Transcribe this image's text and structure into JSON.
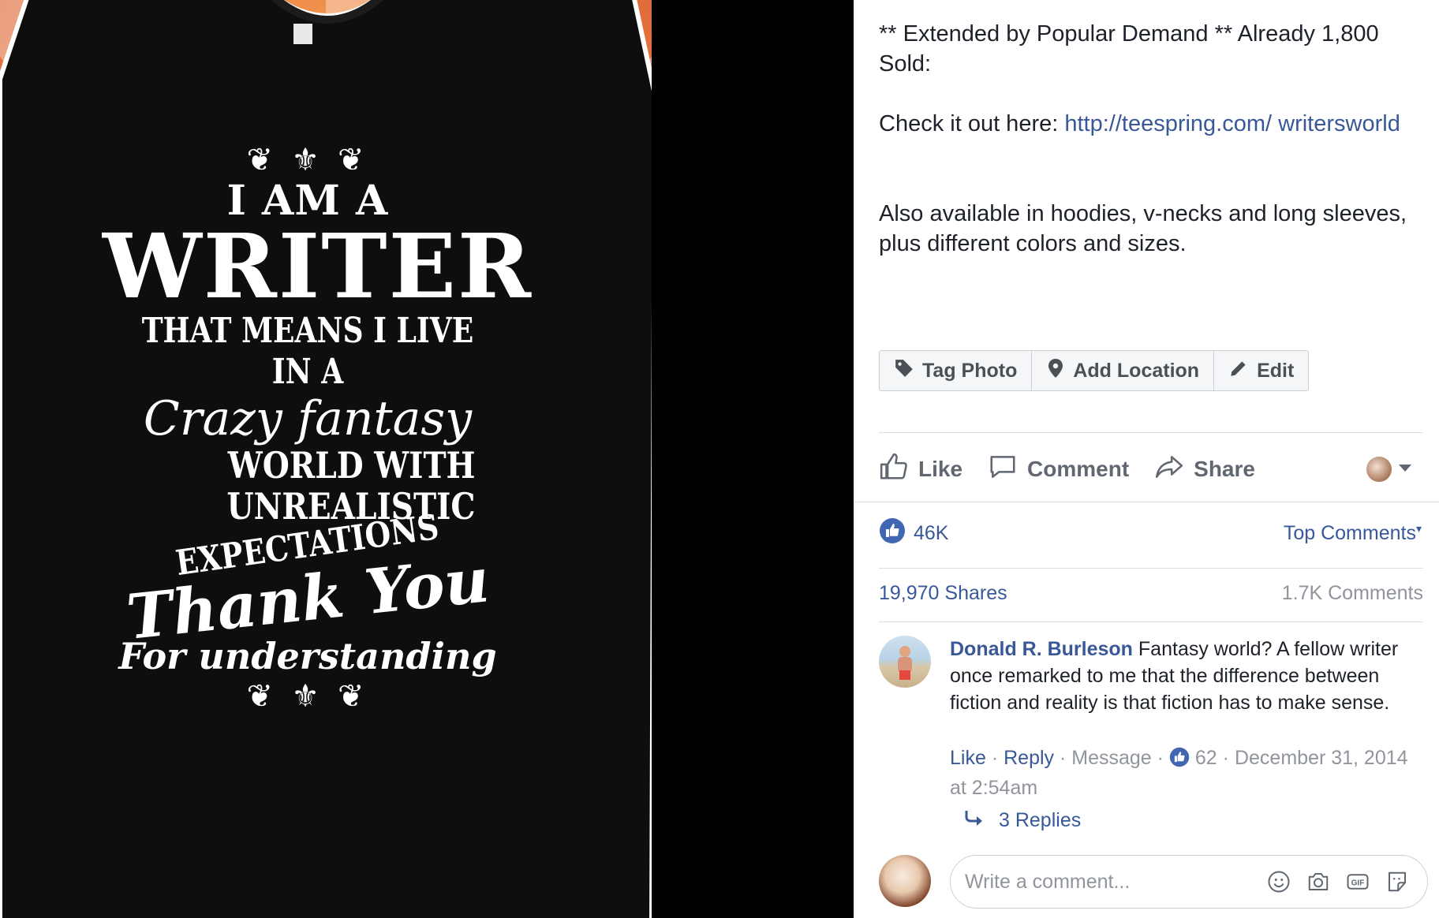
{
  "shirt": {
    "line1": "I AM A",
    "line2": "WRITER",
    "line3": "THAT MEANS I LIVE IN A",
    "line4": "Crazy fantasy",
    "line5": "WORLD WITH",
    "line6": "UNREALISTIC",
    "line7": "EXPECTATIONS",
    "line8": "Thank You",
    "line9": "For understanding"
  },
  "post": {
    "headline": "** Extended by Popular Demand ** Already 1,800 Sold:",
    "checkout_prefix": "Check it out here: ",
    "link_text": "http://teespring.com/ writersworld",
    "availability": "Also available in hoodies, v-necks and long sleeves, plus different colors and sizes."
  },
  "photo_actions": {
    "tag_label": "Tag Photo",
    "location_label": "Add Location",
    "edit_label": "Edit"
  },
  "ufi": {
    "like_label": "Like",
    "comment_label": "Comment",
    "share_label": "Share"
  },
  "stats": {
    "reaction_count": "46K",
    "top_comments_label": "Top Comments",
    "shares": "19,970 Shares",
    "comments": "1.7K Comments"
  },
  "comment": {
    "author": "Donald R. Burleson",
    "text": " Fantasy world? A fellow writer once remarked to me that the difference between fiction and reality is that fiction has to make sense.",
    "like": "Like",
    "reply": "Reply",
    "message": "Message",
    "likes": "62",
    "date": "December 31, 2014 at 2:54am",
    "replies": "3 Replies"
  },
  "composer": {
    "placeholder": "Write a comment..."
  },
  "icons": {
    "tag": "tag-icon",
    "location": "location-pin-icon",
    "edit": "pencil-icon",
    "like": "thumbs-up-icon",
    "comment": "speech-bubble-icon",
    "share": "share-arrow-icon",
    "emoji": "smiley-icon",
    "camera": "camera-icon",
    "gif": "gif-icon",
    "sticker": "sticker-icon"
  },
  "colors": {
    "link": "#385898",
    "like_blue": "#4267b2",
    "muted": "#90949c"
  }
}
